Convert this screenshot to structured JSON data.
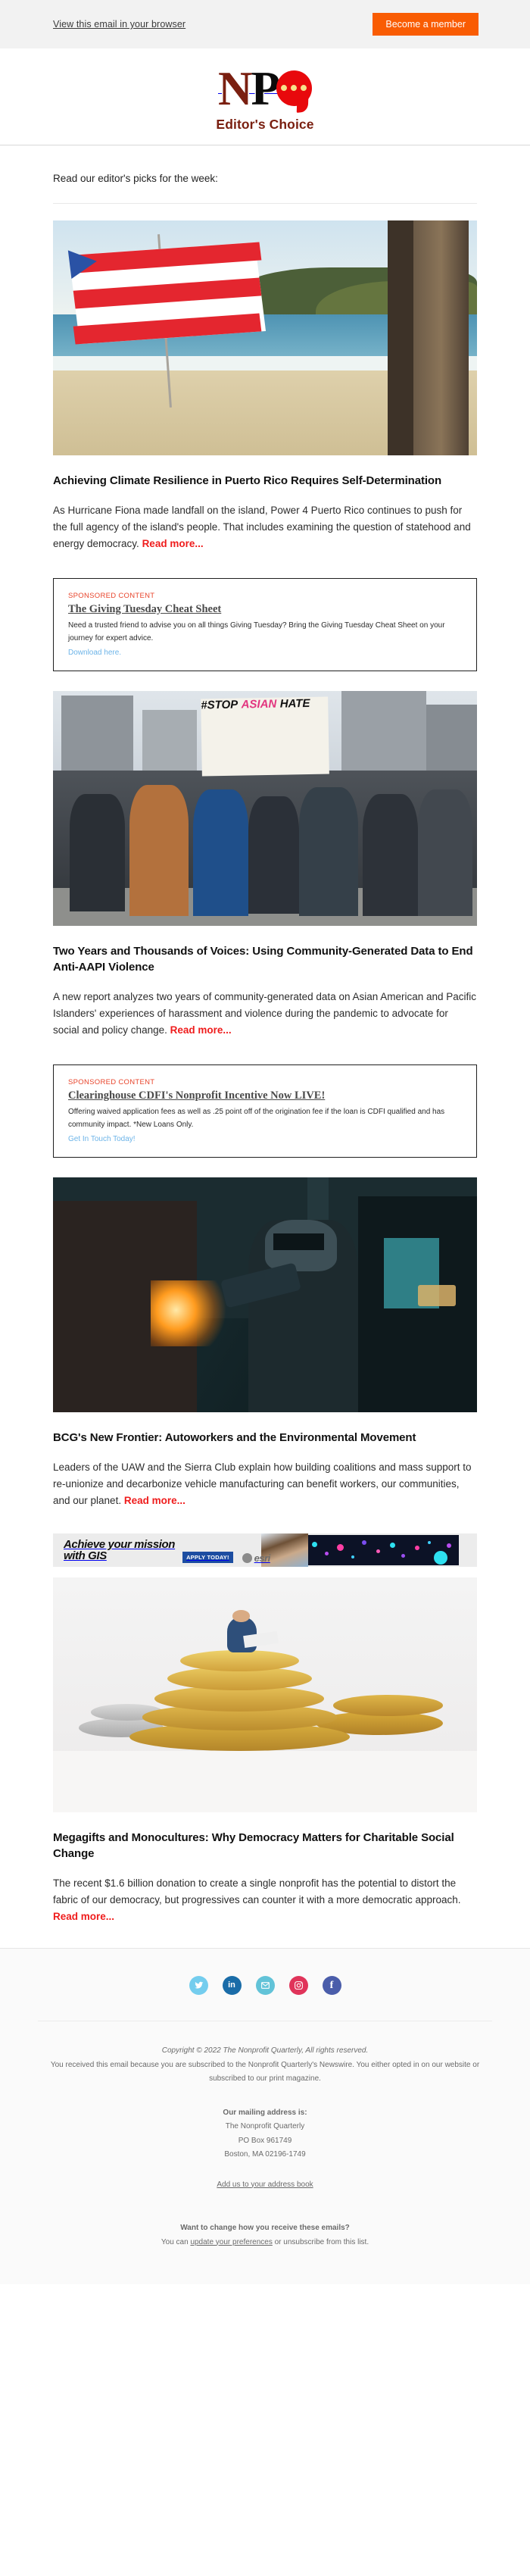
{
  "preheader": {
    "view_in_browser": "View this email in your browser",
    "member_button": "Become a member",
    "background": "#f2f2f2",
    "button_color": "#f95c03"
  },
  "masthead": {
    "logo_letters": [
      "N",
      "P"
    ],
    "logo_alt": "NPQ",
    "title": "Editor's Choice",
    "brand_color": "#7a1f10",
    "bubble_color": "#e8090c"
  },
  "intro": "Read our editor's picks for the week:",
  "read_more_label": "Read more...",
  "accent_red": "#ef1c1c",
  "articles": [
    {
      "image_name": "puerto-rico-flag-beach-photo",
      "title": "Achieving Climate Resilience in Puerto Rico Requires Self-Determination",
      "body": "As Hurricane Fiona made landfall on the island, Power 4 Puerto Rico continues to push for the full agency of the island's people. That includes examining the question of statehood and energy democracy. ",
      "read_more": "Read more..."
    },
    {
      "image_name": "stop-asian-hate-protest-photo",
      "title": "Two Years and Thousands of Voices: Using Community-Generated Data to End Anti-AAPI Violence",
      "body": "A new report analyzes two years of community-generated data on Asian American and Pacific Islanders' experiences of harassment and violence during the pandemic to advocate for social and policy change.  ",
      "read_more": "Read more..."
    },
    {
      "image_name": "autoworker-welding-photo",
      "title": "BCG's New Frontier: Autoworkers and the Environmental Movement",
      "body": "Leaders of the UAW and the Sierra Club explain how building coalitions and mass support to re-unionize and decarbonize vehicle manufacturing can benefit workers, our communities, and our planet. ",
      "read_more": "Read more..."
    },
    {
      "image_name": "stacked-coins-figure-photo",
      "title": "Megagifts and Monocultures: Why Democracy Matters for Charitable Social Change",
      "body": "The recent $1.6 billion donation to create a single nonprofit has the potential to distort the fabric of our democracy, but progressives can counter it with a more democratic approach. ",
      "read_more": "Read more..."
    }
  ],
  "sponsored": [
    {
      "label": "SPONSORED CONTENT",
      "title": "The Giving Tuesday Cheat Sheet",
      "text": "Need a trusted friend to advise you on all things Giving Tuesday? Bring the Giving Tuesday Cheat Sheet on your journey for expert advice.",
      "link": "Download here."
    },
    {
      "label": "SPONSORED CONTENT",
      "title": "Clearinghouse CDFI's Nonprofit Incentive Now LIVE!",
      "text": "Offering waived application fees as well as .25 point off of the origination fee if the loan is CDFI qualified and has community impact. *New Loans Only.",
      "link": "Get In Touch Today!"
    }
  ],
  "banner_ad": {
    "headline_line1": "Achieve your mission",
    "headline_line2": "with GIS",
    "cta": "APPLY TODAY!",
    "brand": "esri"
  },
  "footer": {
    "social": [
      {
        "name": "twitter",
        "glyph": "ᵛ",
        "label": "Twitter",
        "color": "#74cdee"
      },
      {
        "name": "linkedin",
        "glyph": "in",
        "label": "LinkedIn",
        "color": "#1a6ca8"
      },
      {
        "name": "email",
        "glyph": "✉",
        "label": "Email",
        "color": "#62c3d8"
      },
      {
        "name": "instagram",
        "glyph": "◎",
        "label": "Instagram",
        "color": "#e0345a"
      },
      {
        "name": "facebook",
        "glyph": "f",
        "label": "Facebook",
        "color": "#4a5daa"
      }
    ],
    "copyright": "Copyright © 2022 The Nonprofit Quarterly, All rights reserved.",
    "subscription_notice": "You received this email because you are subscribed to the Nonprofit Quarterly's Newswire. You either opted in on our website or subscribed to our print magazine.",
    "address_heading": "Our mailing address is:",
    "address_line1": "The Nonprofit Quarterly",
    "address_line2": "PO Box 961749",
    "address_line3": "Boston, MA 02196-1749",
    "address_book_link": "Add us to your address book",
    "prefs_heading": "Want to change how you receive these emails?",
    "prefs_prefix": "You can ",
    "prefs_link": "update your preferences",
    "prefs_suffix": " or unsubscribe from this list."
  }
}
